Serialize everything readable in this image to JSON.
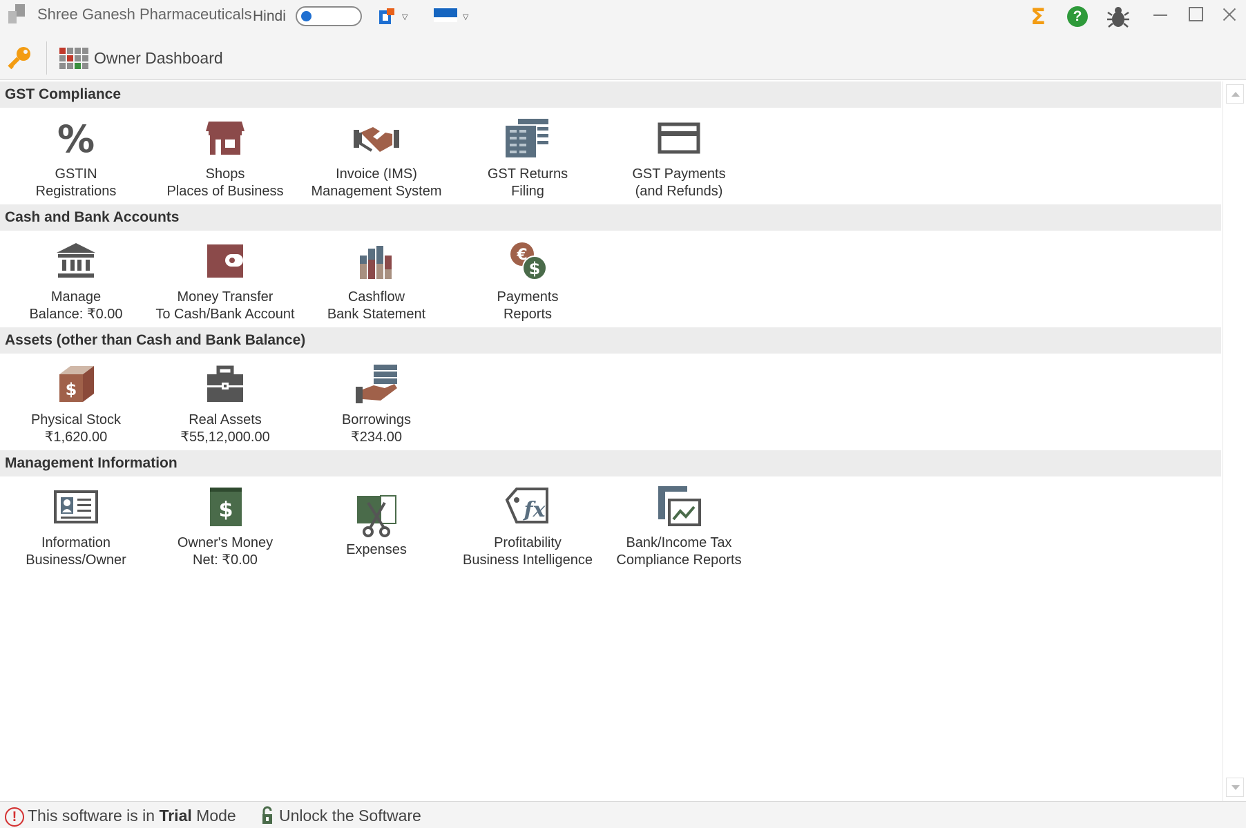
{
  "window": {
    "title": "Shree Ganesh Pharmaceuticals",
    "language_label": "Hindi"
  },
  "toolbar": {
    "dashboard_label": "Owner Dashboard"
  },
  "sections": [
    {
      "title": "GST Compliance",
      "tiles": [
        {
          "icon": "percent-icon",
          "line1": "GSTIN",
          "line2": "Registrations"
        },
        {
          "icon": "shop-icon",
          "line1": "Shops",
          "line2": "Places of Business"
        },
        {
          "icon": "handshake-icon",
          "line1": "Invoice (IMS)",
          "line2": "Management System"
        },
        {
          "icon": "returns-icon",
          "line1": "GST Returns",
          "line2": "Filing"
        },
        {
          "icon": "card-icon",
          "line1": "GST Payments",
          "line2": "(and Refunds)"
        }
      ]
    },
    {
      "title": "Cash and Bank Accounts",
      "tiles": [
        {
          "icon": "bank-icon",
          "line1": "Manage",
          "line2": "Balance: ₹0.00"
        },
        {
          "icon": "wallet-icon",
          "line1": "Money Transfer",
          "line2": "To Cash/Bank Account"
        },
        {
          "icon": "cashflow-chart-icon",
          "line1": "Cashflow",
          "line2": "Bank Statement"
        },
        {
          "icon": "currency-coins-icon",
          "line1": "Payments",
          "line2": "Reports"
        }
      ]
    },
    {
      "title": "Assets (other than Cash and Bank Balance)",
      "tiles": [
        {
          "icon": "stock-box-icon",
          "line1": "Physical Stock",
          "line2": "₹1,620.00"
        },
        {
          "icon": "briefcase-icon",
          "line1": "Real Assets",
          "line2": "₹55,12,000.00"
        },
        {
          "icon": "borrowing-hand-icon",
          "line1": "Borrowings",
          "line2": "₹234.00"
        }
      ]
    },
    {
      "title": "Management Information",
      "tiles": [
        {
          "icon": "id-card-icon",
          "line1": "Information",
          "line2": "Business/Owner"
        },
        {
          "icon": "money-book-icon",
          "line1": "Owner's Money",
          "line2": "Net: ₹0.00"
        },
        {
          "icon": "scissors-icon",
          "line1": "Expenses",
          "line2": ""
        },
        {
          "icon": "function-tag-icon",
          "line1": "Profitability",
          "line2": "Business Intelligence"
        },
        {
          "icon": "report-chart-icon",
          "line1": "Bank/Income Tax",
          "line2": "Compliance Reports"
        }
      ]
    }
  ],
  "status": {
    "trial_prefix": "This software is in",
    "trial_bold": "Trial",
    "trial_suffix": "Mode",
    "unlock_label": "Unlock the Software"
  },
  "colors": {
    "accent_orange": "#f39c12",
    "help_green": "#2e9a3a",
    "warn_red": "#d32f2f",
    "toggle_blue": "#1f6fd1"
  }
}
